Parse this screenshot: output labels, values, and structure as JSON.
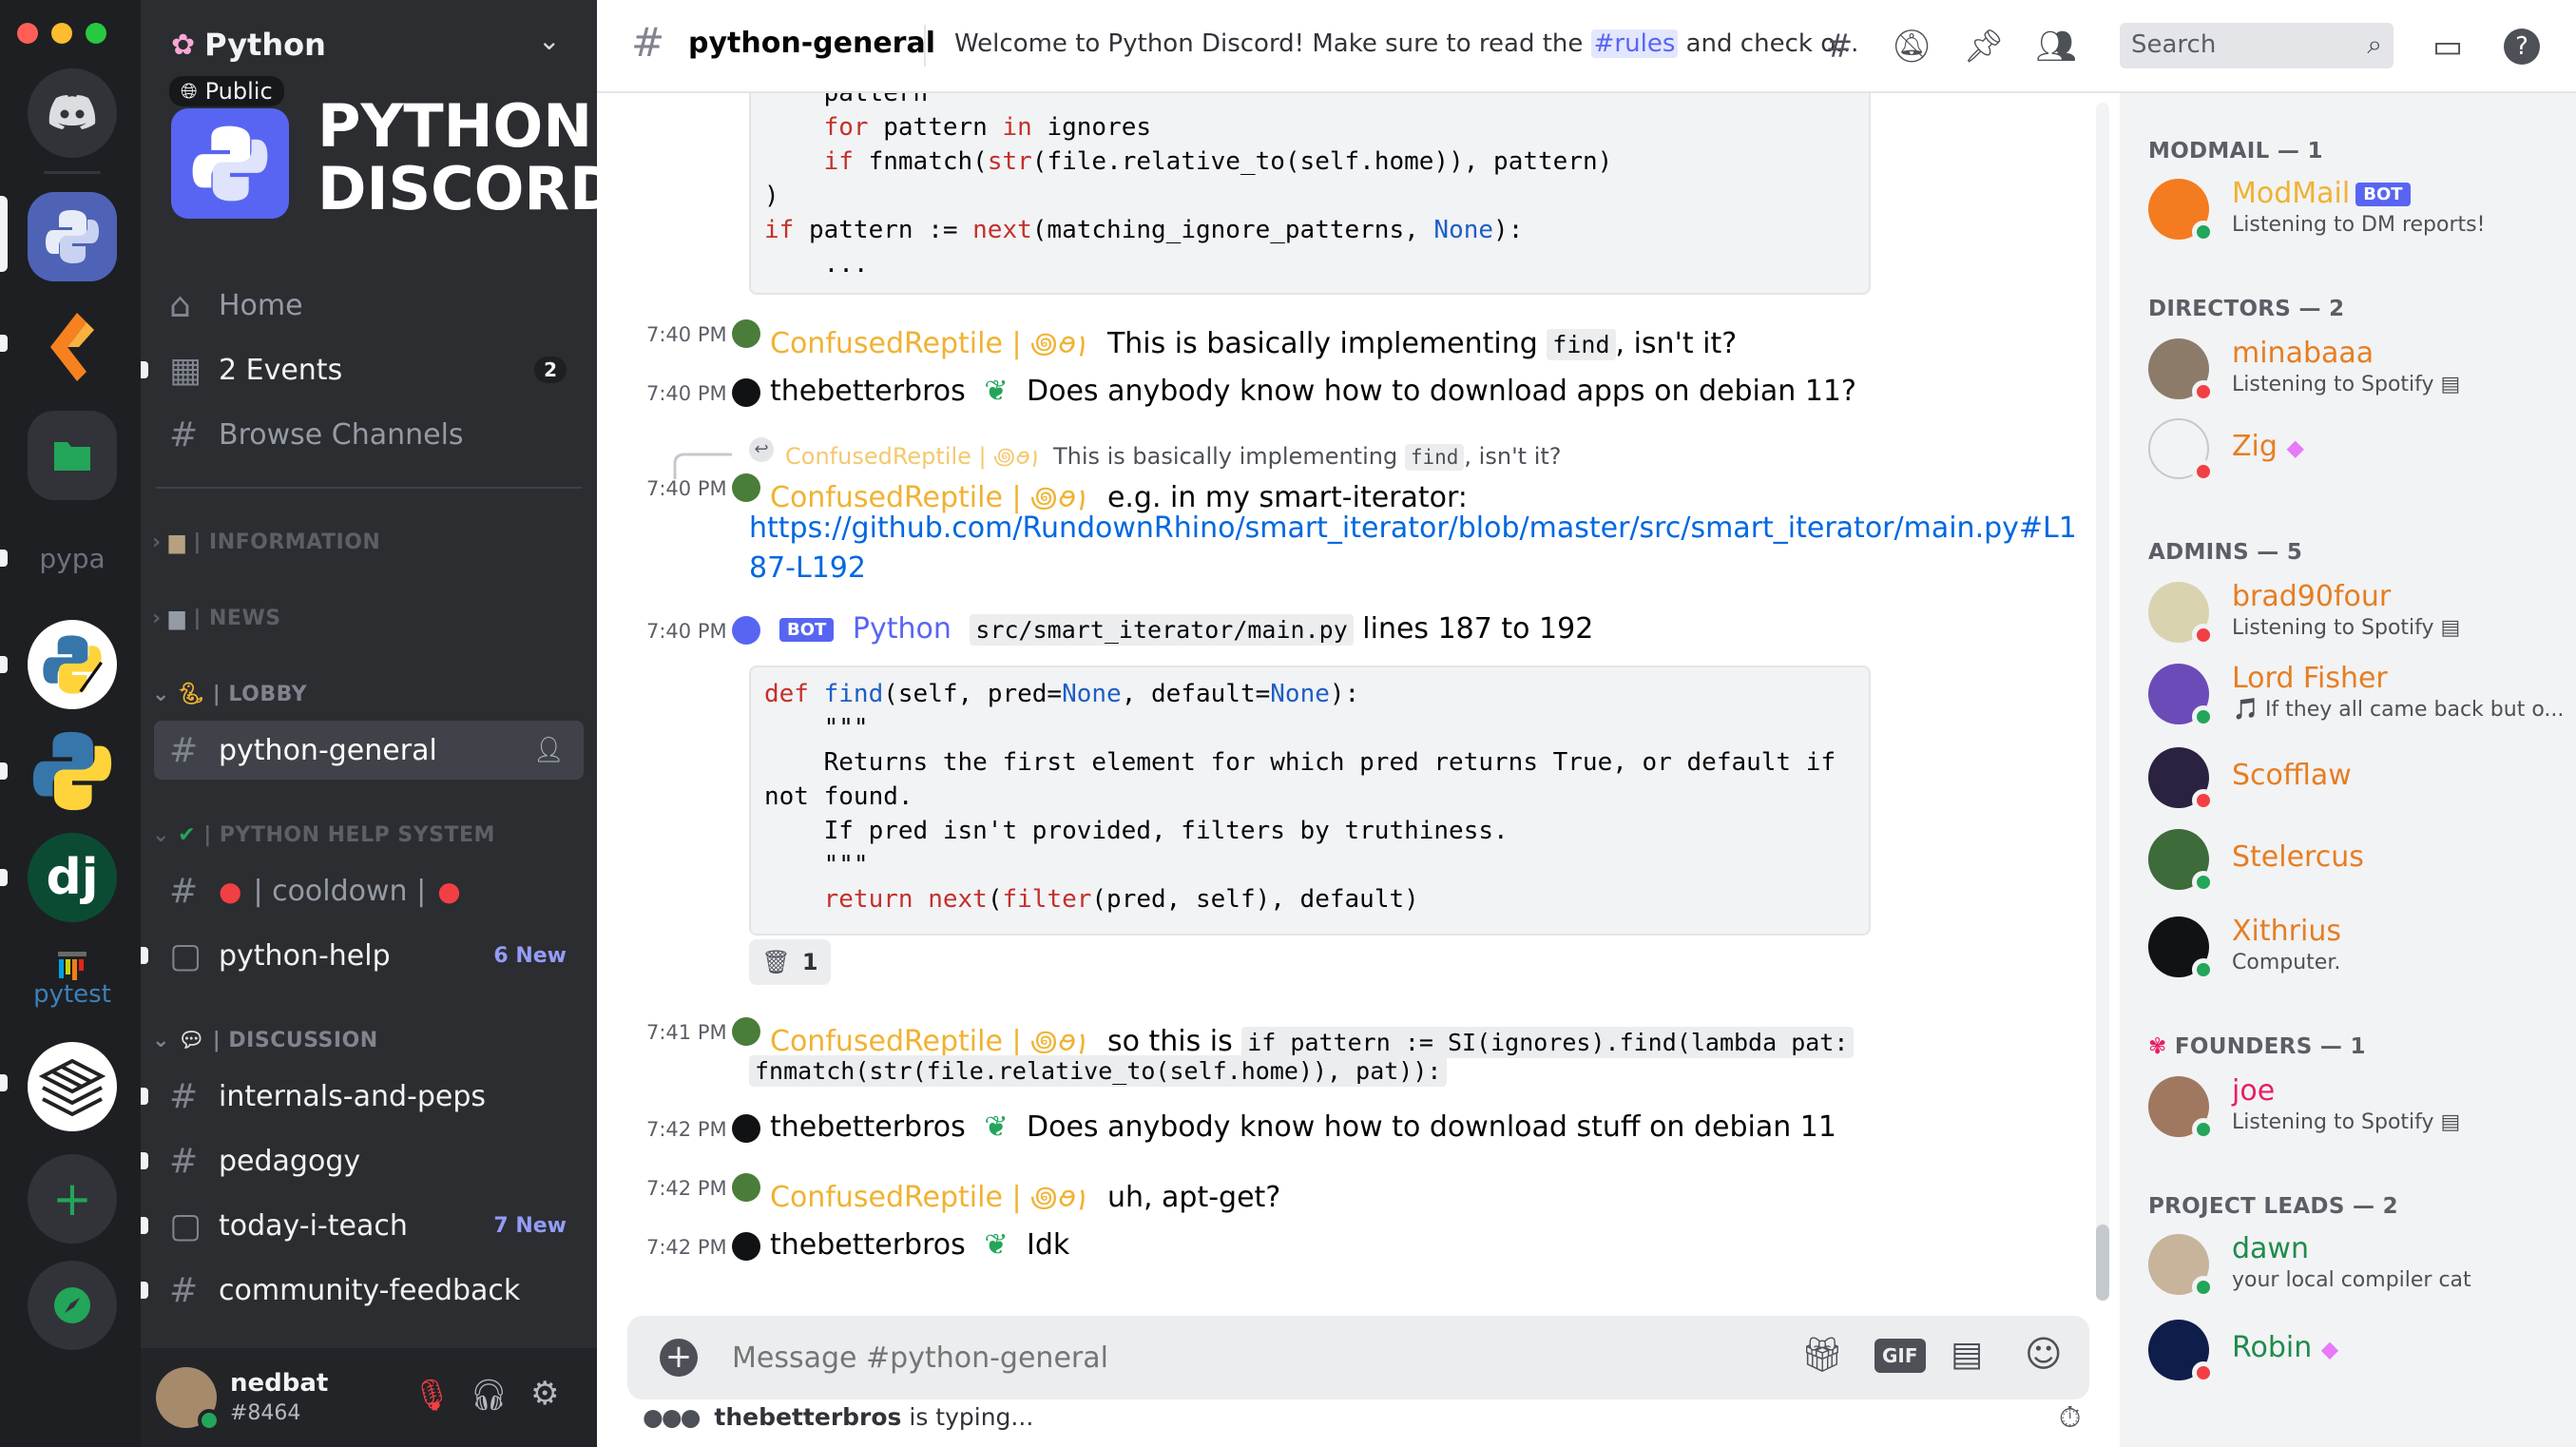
{
  "colors": {
    "blurple": "#5865f2",
    "green": "#23a55a",
    "red": "#f23f43",
    "confused_reptile": "#f0b232",
    "link": "#0068e0"
  },
  "server": {
    "name": "Python",
    "visibility": "Public",
    "banner_line1": "PYTHON",
    "banner_line2": "DISCORD"
  },
  "rail": {
    "items": [
      "discord-home",
      "python",
      "kite",
      "folder",
      "pypa",
      "python-sketch",
      "python-blue",
      "django",
      "pytest",
      "pallets",
      "add-server",
      "explore"
    ],
    "pypa_label": "pypa",
    "pytest_label": "pytest",
    "django_label": "dj"
  },
  "nav": {
    "home": "Home",
    "events": "2 Events",
    "events_count": "2",
    "browse": "Browse Channels"
  },
  "categories": {
    "information": "| INFORMATION",
    "news": "| NEWS",
    "lobby": "| LOBBY",
    "help": "| PYTHON HELP SYSTEM",
    "discussion": "| DISCUSSION"
  },
  "channels": {
    "python_general": "python-general",
    "cooldown": "| cooldown |",
    "python_help": "python-help",
    "python_help_new": "6 New",
    "internals": "internals-and-peps",
    "pedagogy": "pedagogy",
    "today_i_teach": "today-i-teach",
    "today_i_teach_new": "7 New",
    "community_feedback": "community-feedback"
  },
  "user": {
    "name": "nedbat",
    "tag": "#8464"
  },
  "header": {
    "channel": "python-general",
    "topic_pre": "Welcome to Python Discord! Make sure to read the ",
    "topic_link": "#rules",
    "topic_post": " and check o...",
    "search_placeholder": "Search"
  },
  "code_top": {
    "l1": "    pattern",
    "l2_kw": "for",
    "l2_rest_a": " pattern ",
    "l2_kw2": "in",
    "l2_rest_b": " ignores",
    "l3_kw": "if",
    "l3_a": " fnmatch(",
    "l3_bi": "str",
    "l3_b": "(file.relative_to(self.home)), pattern)",
    "l4": ")",
    "l5_kw": "if",
    "l5_a": " pattern := ",
    "l5_bi": "next",
    "l5_b": "(matching_ignore_patterns, ",
    "l5_none": "None",
    "l5_c": "):",
    "l6": "    ..."
  },
  "messages": [
    {
      "time": "7:40 PM",
      "author": "ConfusedReptile | ꩜ꪮ꩝",
      "pre": "This is basically implementing ",
      "code": "find",
      "post": ", isn't it?"
    },
    {
      "time": "7:40 PM",
      "author": "thebetterbros",
      "text": "Does anybody know how to download apps on debian 11?"
    },
    {
      "time": "7:40 PM",
      "author": "ConfusedReptile | ꩜ꪮ꩝",
      "reply_author": "ConfusedReptile | ꩜ꪮ꩝",
      "reply_pre": "This is basically implementing ",
      "reply_code": "find",
      "reply_post": ", isn't it?",
      "text": "e.g. in my smart-iterator:",
      "link1": "https://github.com/RundownRhino/smart_iterator/blob/master/src/smart_iterator/main.py#L1",
      "link2": "87-L192"
    },
    {
      "time": "7:40 PM",
      "author": "Python",
      "badge": "BOT",
      "code": "src/smart_iterator/main.py",
      "post": " lines 187 to 192"
    },
    {
      "time": "7:41 PM",
      "author": "ConfusedReptile | ꩜ꪮ꩝",
      "pre": "so this is ",
      "code1": "if pattern := SI(ignores).find(lambda pat:",
      "code2": "fnmatch(str(file.relative_to(self.home)), pat)):"
    },
    {
      "time": "7:42 PM",
      "author": "thebetterbros",
      "text": "Does anybody know how to download stuff on debian 11"
    },
    {
      "time": "7:42 PM",
      "author": "ConfusedReptile | ꩜ꪮ꩝",
      "text": "uh, apt-get?"
    },
    {
      "time": "7:42 PM",
      "author": "thebetterbros",
      "text": "Idk"
    }
  ],
  "code_find": {
    "l1_kw": "def",
    "l1_fn": "find",
    "l1_a": "(self, pred=",
    "l1_none": "None",
    "l1_b": ", default=",
    "l1_none2": "None",
    "l1_c": "):",
    "l2": "    \"\"\"",
    "l3": "    Returns the first element for which pred returns True, or default if",
    "l4": "not found.",
    "l5": "    If pred isn't provided, filters by truthiness.",
    "l6": "    \"\"\"",
    "l7_kw": "return",
    "l7_bi": "next",
    "l7_a": "(",
    "l7_bi2": "filter",
    "l7_b": "(pred, self), default)"
  },
  "reaction": {
    "emoji": "wastebasket-icon",
    "count": "1"
  },
  "composer": {
    "placeholder": "Message #python-general"
  },
  "typing": {
    "user": "thebetterbros",
    "suffix": " is typing..."
  },
  "members": {
    "modmail_cat": "MODMAIL — 1",
    "directors_cat": "DIRECTORS — 2",
    "admins_cat": "ADMINS — 5",
    "founders_cat": "FOUNDERS — 1",
    "leads_cat": "PROJECT LEADS — 2",
    "list": [
      {
        "name": "ModMail",
        "badge": "BOT",
        "activity": "Listening to DM reports!",
        "color": "#f0b232"
      },
      {
        "name": "minabaaa",
        "activity": "Listening to Spotify",
        "color": "#e67e22"
      },
      {
        "name": "Zig",
        "activity": "",
        "color": "#e67e22"
      },
      {
        "name": "brad90four",
        "activity": "Listening to Spotify",
        "color": "#e67e22"
      },
      {
        "name": "Lord Fisher",
        "activity": "If they all came back but o...",
        "color": "#e67e22"
      },
      {
        "name": "Scofflaw",
        "activity": "",
        "color": "#e67e22"
      },
      {
        "name": "Stelercus",
        "activity": "",
        "color": "#e67e22"
      },
      {
        "name": "Xithrius",
        "activity": "Computer.",
        "color": "#e67e22"
      },
      {
        "name": "joe",
        "activity": "Listening to Spotify",
        "color": "#e91e63"
      },
      {
        "name": "dawn",
        "activity": "your local compiler cat",
        "color": "#1f8b4c"
      },
      {
        "name": "Robin",
        "activity": "",
        "color": "#1f8b4c"
      }
    ]
  }
}
